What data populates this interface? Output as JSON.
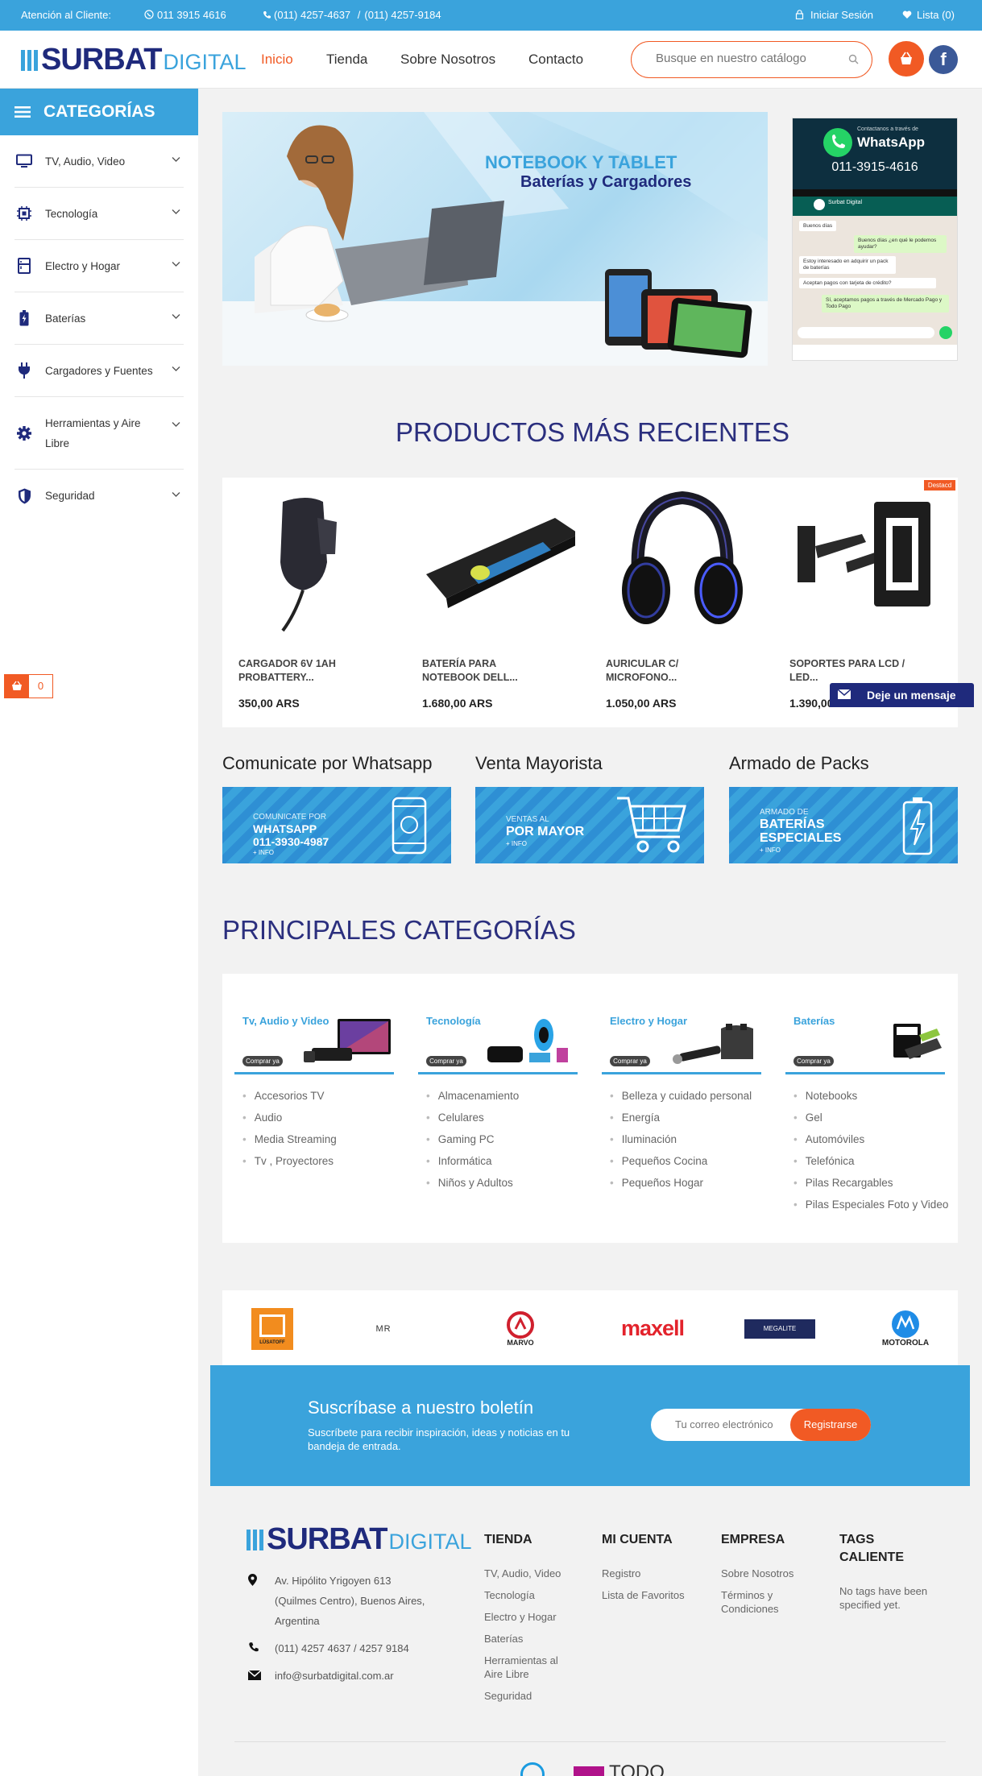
{
  "topbar": {
    "attention": "Atención al Cliente:",
    "whatsapp": "011 3915 4616",
    "phone1": "(011) 4257-4637",
    "sep": "/",
    "phone2": "(011) 4257-9184",
    "login": "Iniciar Sesión",
    "wishlist": "Lista (0)"
  },
  "header": {
    "logo_bold": "SURBAT",
    "logo_light": "DIGITAL",
    "nav": [
      "Inicio",
      "Tienda",
      "Sobre Nosotros",
      "Contacto"
    ],
    "search_placeholder": "Busque en nuestro catálogo"
  },
  "sidebar": {
    "title": "CATEGORÍAS",
    "items": [
      {
        "label": "TV, Audio, Video",
        "icon": "monitor-icon"
      },
      {
        "label": "Tecnología",
        "icon": "chip-icon"
      },
      {
        "label": "Electro y Hogar",
        "icon": "fridge-icon"
      },
      {
        "label": "Baterías",
        "icon": "battery-icon"
      },
      {
        "label": "Cargadores y Fuentes",
        "icon": "plug-icon"
      },
      {
        "label": "Herramientas y Aire Libre",
        "icon": "gear-icon"
      },
      {
        "label": "Seguridad",
        "icon": "shield-icon"
      }
    ],
    "cart_count": "0"
  },
  "banner": {
    "title": "NOTEBOOK Y TABLET",
    "subtitle": "Baterías y Cargadores"
  },
  "whatsapp_card": {
    "small": "Contactanos a través de",
    "brand": "WhatsApp",
    "number": "011-3915-4616",
    "contact": "Surbat Digital",
    "chat": [
      "Buenos días",
      "Buenos días ¿en qué le podemos ayudar?",
      "Estoy interesado en adquirir un pack de baterías",
      "Aceptan pagos con tarjeta de crédito?",
      "Sí, aceptamos pagos a través de Mercado Pago y Todo Pago"
    ]
  },
  "recent": {
    "title": "PRODUCTOS MÁS RECIENTES",
    "badge": "Destacd",
    "products": [
      {
        "name": "CARGADOR 6V 1AH PROBATTERY...",
        "price": "350,00 ARS",
        "icon": "charger-image"
      },
      {
        "name": "BATERÍA PARA NOTEBOOK DELL...",
        "price": "1.680,00 ARS",
        "icon": "laptop-battery-image"
      },
      {
        "name": "AURICULAR C/ MICROFONO...",
        "price": "1.050,00 ARS",
        "icon": "headset-image"
      },
      {
        "name": "SOPORTES PARA LCD / LED...",
        "price": "1.390,00 ARS",
        "icon": "tv-mount-image"
      }
    ]
  },
  "message_button": "Deje un mensaje",
  "promos": [
    {
      "title": "Comunicate por Whatsapp",
      "line1": "COMUNICATE POR",
      "line2": "WHATSAPP",
      "line3": "011-3930-4987",
      "more": "+ INFO"
    },
    {
      "title": "Venta Mayorista",
      "line1": "VENTAS AL",
      "line2": "POR MAYOR",
      "more": "+ INFO"
    },
    {
      "title": "Armado de Packs",
      "line1": "ARMADO DE",
      "line2": "BATERÍAS",
      "line3": "ESPECIALES",
      "more": "+ INFO"
    }
  ],
  "main_categories": {
    "title": "PRINCIPALES CATEGORÍAS",
    "buy": "Comprar ya",
    "cols": [
      {
        "title": "Tv, Audio y Video",
        "items": [
          "Accesorios TV",
          "Audio",
          "Media Streaming",
          "Tv , Proyectores"
        ]
      },
      {
        "title": "Tecnología",
        "items": [
          "Almacenamiento",
          "Celulares",
          "Gaming PC",
          "Informática",
          "Niños y Adultos"
        ]
      },
      {
        "title": "Electro y Hogar",
        "items": [
          "Belleza y cuidado personal",
          "Energía",
          "Iluminación",
          "Pequeños Cocina",
          "Pequeños Hogar"
        ]
      },
      {
        "title": "Baterías",
        "items": [
          "Notebooks",
          "Gel",
          "Automóviles",
          "Telefónica",
          "Pilas Recargables",
          "Pilas Especiales Foto y Video"
        ]
      }
    ]
  },
  "brands": [
    "LÜSATOFF",
    "MR",
    "MARVO",
    "maxell",
    "MEGALITE",
    "MOTOROLA"
  ],
  "newsletter": {
    "title": "Suscríbase a nuestro boletín",
    "text": "Suscríbete para recibir inspiración, ideas y noticias en tu bandeja de entrada.",
    "placeholder": "Tu correo electrónico",
    "button": "Registrarse"
  },
  "footer": {
    "address": "Av. Hipólito Yrigoyen 613 (Quilmes Centro), Buenos Aires, Argentina",
    "phone": "(011) 4257 4637 / 4257 9184",
    "email": "info@surbatdigital.com.ar",
    "cols": [
      {
        "title": "TIENDA",
        "items": [
          "TV, Audio, Video",
          "Tecnología",
          "Electro y Hogar",
          "Baterías",
          "Herramientas al Aire Libre",
          "Seguridad"
        ]
      },
      {
        "title": "MI CUENTA",
        "items": [
          "Registro",
          "Lista de Favoritos"
        ]
      },
      {
        "title": "EMPRESA",
        "items": [
          "Sobre Nosotros",
          "Términos y Condiciones"
        ]
      },
      {
        "title": "TAGS CALIENTE",
        "items": [
          "No tags have been specified yet."
        ]
      }
    ],
    "bottom_brand": "TODO"
  },
  "colors": {
    "primary": "#3aa3dc",
    "accent": "#f15a24",
    "navy": "#1f2a7c",
    "title": "#2b2f7e"
  }
}
